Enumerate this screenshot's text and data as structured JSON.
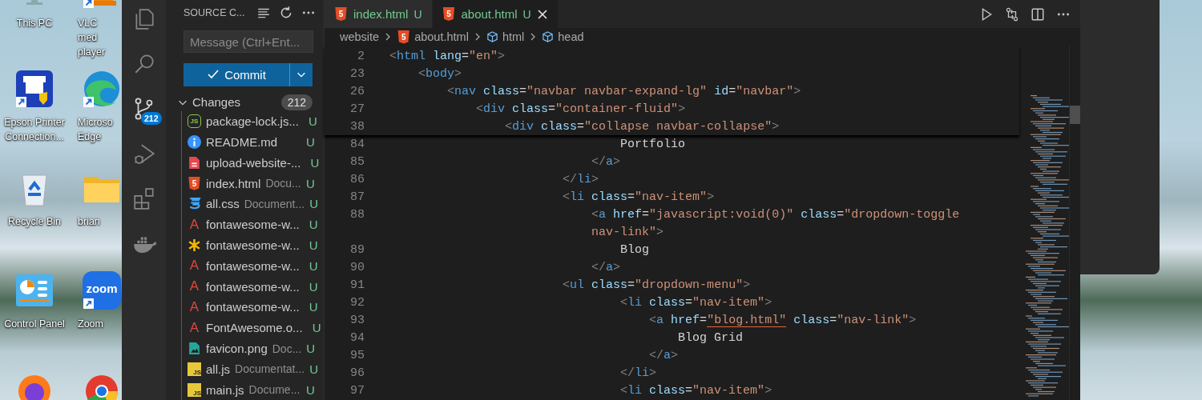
{
  "desktop": {
    "icons": [
      {
        "kind": "monitor",
        "label": "This PC",
        "shortcut": false
      },
      {
        "kind": "printer",
        "label": "Epson Printer Connection...",
        "shortcut": true
      },
      {
        "kind": "recycle",
        "label": "Recycle Bin",
        "shortcut": false
      },
      {
        "kind": "control",
        "label": "Control Panel",
        "shortcut": false
      },
      {
        "kind": "firefox",
        "shortcut": false
      },
      {
        "kind": "cone",
        "label": "VLC med player",
        "shortcut": true
      },
      {
        "kind": "edge",
        "label": "Microso Edge",
        "shortcut": true
      },
      {
        "kind": "folder",
        "label": "brian",
        "shortcut": false
      },
      {
        "kind": "zoom",
        "label": "Zoom",
        "logo_text": "zoom",
        "shortcut": true
      },
      {
        "kind": "chrome",
        "shortcut": false
      }
    ]
  },
  "activity_bar": {
    "items": [
      {
        "kind": "explorer",
        "selected": false
      },
      {
        "kind": "search",
        "selected": false
      },
      {
        "kind": "source-control",
        "selected": true,
        "badge": "212"
      },
      {
        "kind": "run-debug",
        "selected": false
      },
      {
        "kind": "extensions",
        "selected": false
      },
      {
        "kind": "docker",
        "selected": false
      }
    ]
  },
  "sidebar": {
    "title": "SOURCE C...",
    "message": {
      "placeholder": "Message (Ctrl+Ent..."
    },
    "commit_button": "Commit",
    "changes": {
      "title": "Changes",
      "count": "212",
      "files": [
        {
          "kind": "nodejs",
          "icon_text": "JS",
          "name": "package-lock.js...",
          "status": "U"
        },
        {
          "kind": "info",
          "name": "README.md",
          "status": "U"
        },
        {
          "kind": "pdf",
          "name": "upload-website-...",
          "status": "U"
        },
        {
          "kind": "html",
          "icon_text": "5",
          "name": "index.html",
          "path": "Docu...",
          "status": "U"
        },
        {
          "kind": "css",
          "name": "all.css",
          "path": "Document...",
          "status": "U"
        },
        {
          "kind": "font",
          "icon_text": "A",
          "name": "fontawesome-w...",
          "status": "U"
        },
        {
          "kind": "asterisk",
          "name": "fontawesome-w...",
          "status": "U"
        },
        {
          "kind": "font",
          "icon_text": "A",
          "name": "fontawesome-w...",
          "status": "U"
        },
        {
          "kind": "font",
          "icon_text": "A",
          "name": "fontawesome-w...",
          "status": "U"
        },
        {
          "kind": "font",
          "icon_text": "A",
          "name": "fontawesome-w...",
          "status": "U"
        },
        {
          "kind": "font",
          "icon_text": "A",
          "name": "FontAwesome.o...",
          "status": "U"
        },
        {
          "kind": "image",
          "name": "favicon.png",
          "path": "Doc...",
          "status": "U"
        },
        {
          "kind": "js",
          "icon_text": "JS",
          "name": "all.js",
          "path": "Documentat...",
          "status": "U"
        },
        {
          "kind": "js",
          "icon_text": "JS",
          "name": "main.js",
          "path": "Docume...",
          "status": "U"
        }
      ]
    }
  },
  "editor": {
    "tabs": [
      {
        "label": "index.html",
        "status": "U",
        "icon_text": "5",
        "selected": false
      },
      {
        "label": "about.html",
        "status": "U",
        "icon_text": "5",
        "selected": true
      }
    ],
    "breadcrumbs": [
      {
        "kind": "folder",
        "label": "website"
      },
      {
        "kind": "file",
        "label": "about.html",
        "icon_text": "5"
      },
      {
        "kind": "symbol",
        "label": "html"
      },
      {
        "kind": "symbol",
        "label": "head"
      }
    ],
    "sticky_lines": [
      {
        "number": "2",
        "tokens": [
          {
            "kind": "punct",
            "text": "<"
          },
          {
            "kind": "tag",
            "text": "html"
          },
          {
            "kind": "attr",
            "text": " lang"
          },
          {
            "kind": "text",
            "text": "="
          },
          {
            "kind": "str",
            "text": "\"en\""
          },
          {
            "kind": "punct",
            "text": ">"
          }
        ]
      },
      {
        "number": "23",
        "tokens": [
          {
            "kind": "punct",
            "text": "    <"
          },
          {
            "kind": "tag",
            "text": "body"
          },
          {
            "kind": "punct",
            "text": ">"
          }
        ]
      },
      {
        "number": "26",
        "tokens": [
          {
            "kind": "punct",
            "text": "        <"
          },
          {
            "kind": "tag",
            "text": "nav"
          },
          {
            "kind": "attr",
            "text": " class"
          },
          {
            "kind": "text",
            "text": "="
          },
          {
            "kind": "str",
            "text": "\"navbar navbar-expand-lg\""
          },
          {
            "kind": "attr",
            "text": " id"
          },
          {
            "kind": "text",
            "text": "="
          },
          {
            "kind": "str",
            "text": "\"navbar\""
          },
          {
            "kind": "punct",
            "text": ">"
          }
        ]
      },
      {
        "number": "27",
        "tokens": [
          {
            "kind": "punct",
            "text": "            <"
          },
          {
            "kind": "tag",
            "text": "div"
          },
          {
            "kind": "attr",
            "text": " class"
          },
          {
            "kind": "text",
            "text": "="
          },
          {
            "kind": "str",
            "text": "\"container-fluid\""
          },
          {
            "kind": "punct",
            "text": ">"
          }
        ]
      },
      {
        "number": "38",
        "tokens": [
          {
            "kind": "punct",
            "text": "                <"
          },
          {
            "kind": "tag",
            "text": "div"
          },
          {
            "kind": "attr",
            "text": " class"
          },
          {
            "kind": "text",
            "text": "="
          },
          {
            "kind": "str",
            "text": "\"collapse navbar-collapse\""
          },
          {
            "kind": "punct",
            "text": ">"
          }
        ]
      }
    ],
    "lines": [
      {
        "number": "84",
        "tokens": [
          {
            "kind": "text",
            "text": "                                Portfolio"
          }
        ]
      },
      {
        "number": "85",
        "tokens": [
          {
            "kind": "punct",
            "text": "                            </"
          },
          {
            "kind": "tag",
            "text": "a"
          },
          {
            "kind": "punct",
            "text": ">"
          }
        ]
      },
      {
        "number": "86",
        "tokens": [
          {
            "kind": "punct",
            "text": "                        </"
          },
          {
            "kind": "tag",
            "text": "li"
          },
          {
            "kind": "punct",
            "text": ">"
          }
        ]
      },
      {
        "number": "87",
        "tokens": [
          {
            "kind": "punct",
            "text": "                        <"
          },
          {
            "kind": "tag",
            "text": "li"
          },
          {
            "kind": "attr",
            "text": " class"
          },
          {
            "kind": "text",
            "text": "="
          },
          {
            "kind": "str",
            "text": "\"nav-item\""
          },
          {
            "kind": "punct",
            "text": ">"
          }
        ]
      },
      {
        "number": "88",
        "tokens": [
          {
            "kind": "punct",
            "text": "                            <"
          },
          {
            "kind": "tag",
            "text": "a"
          },
          {
            "kind": "attr",
            "text": " href"
          },
          {
            "kind": "text",
            "text": "="
          },
          {
            "kind": "str",
            "text": "\"javascript:void(0)\""
          },
          {
            "kind": "attr",
            "text": " class"
          },
          {
            "kind": "text",
            "text": "="
          },
          {
            "kind": "str",
            "text": "\"dropdown-toggle"
          }
        ]
      },
      {
        "tokens": [
          {
            "kind": "str",
            "text": "                            nav-link\""
          },
          {
            "kind": "punct",
            "text": ">"
          }
        ]
      },
      {
        "number": "89",
        "tokens": [
          {
            "kind": "text",
            "text": "                                Blog"
          }
        ]
      },
      {
        "number": "90",
        "tokens": [
          {
            "kind": "punct",
            "text": "                            </"
          },
          {
            "kind": "tag",
            "text": "a"
          },
          {
            "kind": "punct",
            "text": ">"
          }
        ]
      },
      {
        "number": "91",
        "tokens": [
          {
            "kind": "punct",
            "text": "                        <"
          },
          {
            "kind": "tag",
            "text": "ul"
          },
          {
            "kind": "attr",
            "text": " class"
          },
          {
            "kind": "text",
            "text": "="
          },
          {
            "kind": "str",
            "text": "\"dropdown-menu\""
          },
          {
            "kind": "punct",
            "text": ">"
          }
        ]
      },
      {
        "number": "92",
        "tokens": [
          {
            "kind": "punct",
            "text": "                                <"
          },
          {
            "kind": "tag",
            "text": "li"
          },
          {
            "kind": "attr",
            "text": " class"
          },
          {
            "kind": "text",
            "text": "="
          },
          {
            "kind": "str",
            "text": "\"nav-item\""
          },
          {
            "kind": "punct",
            "text": ">"
          }
        ]
      },
      {
        "number": "93",
        "tokens": [
          {
            "kind": "punct",
            "text": "                                    <"
          },
          {
            "kind": "tag",
            "text": "a"
          },
          {
            "kind": "attr",
            "text": " href"
          },
          {
            "kind": "text",
            "text": "="
          },
          {
            "kind": "str",
            "text": "\"blog.html\"",
            "underline": true
          },
          {
            "kind": "attr",
            "text": " class"
          },
          {
            "kind": "text",
            "text": "="
          },
          {
            "kind": "str",
            "text": "\"nav-link\""
          },
          {
            "kind": "punct",
            "text": ">"
          }
        ]
      },
      {
        "number": "94",
        "tokens": [
          {
            "kind": "text",
            "text": "                                        Blog Grid"
          }
        ]
      },
      {
        "number": "95",
        "tokens": [
          {
            "kind": "punct",
            "text": "                                    </"
          },
          {
            "kind": "tag",
            "text": "a"
          },
          {
            "kind": "punct",
            "text": ">"
          }
        ]
      },
      {
        "number": "96",
        "tokens": [
          {
            "kind": "punct",
            "text": "                                </"
          },
          {
            "kind": "tag",
            "text": "li"
          },
          {
            "kind": "punct",
            "text": ">"
          }
        ]
      },
      {
        "number": "97",
        "tokens": [
          {
            "kind": "punct",
            "text": "                                <"
          },
          {
            "kind": "tag",
            "text": "li"
          },
          {
            "kind": "attr",
            "text": " class"
          },
          {
            "kind": "text",
            "text": "="
          },
          {
            "kind": "str",
            "text": "\"nav-item\""
          },
          {
            "kind": "punct",
            "text": ">"
          }
        ]
      }
    ]
  }
}
